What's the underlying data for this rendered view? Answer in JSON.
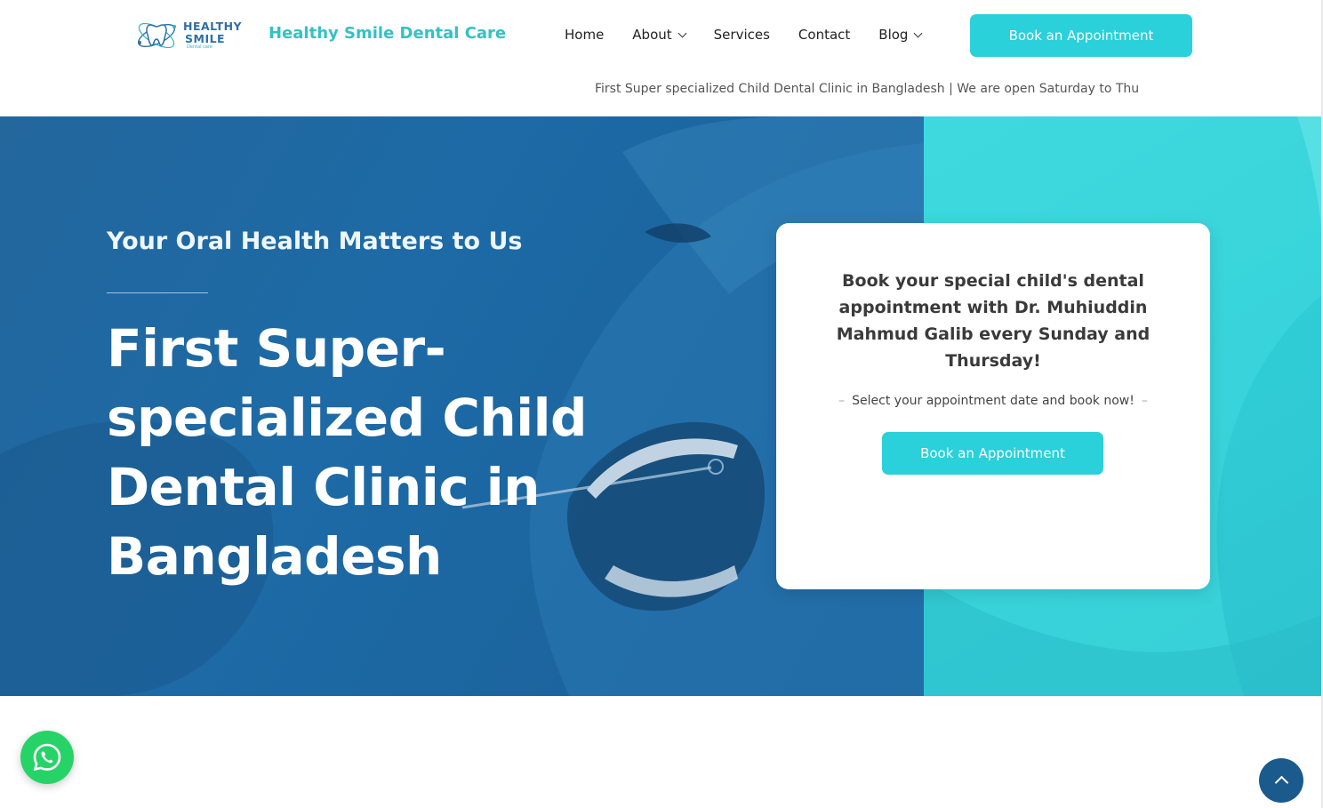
{
  "header": {
    "logo": {
      "line1": "HEALTHY",
      "line2": "SMILE",
      "sub": "Dental care"
    },
    "site_title": "Healthy Smile Dental Care",
    "nav": [
      {
        "label": "Home",
        "has_dropdown": false
      },
      {
        "label": "About",
        "has_dropdown": true
      },
      {
        "label": "Services",
        "has_dropdown": false
      },
      {
        "label": "Contact",
        "has_dropdown": false
      },
      {
        "label": "Blog",
        "has_dropdown": true
      }
    ],
    "cta_label": "Book an Appointment",
    "ticker": "First Super specialized Child Dental Clinic in Bangladesh | We are open Saturday to Thu"
  },
  "hero": {
    "tagline": "Your Oral Health Matters to Us",
    "headline": "First Super-specialized Child Dental Clinic in Bangladesh",
    "card": {
      "title": "Book your special child's dental appointment with Dr. Muhiuddin Mahmud Galib every Sunday and Thursday!",
      "subtitle": "Select your appointment date and book now!",
      "button_label": "Book an Appointment"
    }
  },
  "floating": {
    "whatsapp_icon": "whatsapp-icon",
    "back_to_top_icon": "chevron-up-icon"
  },
  "colors": {
    "accent": "#2ad0da",
    "title_teal": "#34c1c5",
    "hero_blue": "#1d6aa6",
    "hero_teal": "#33d1d8",
    "whatsapp_green": "#26d367",
    "top_button": "#1a5a8c"
  }
}
